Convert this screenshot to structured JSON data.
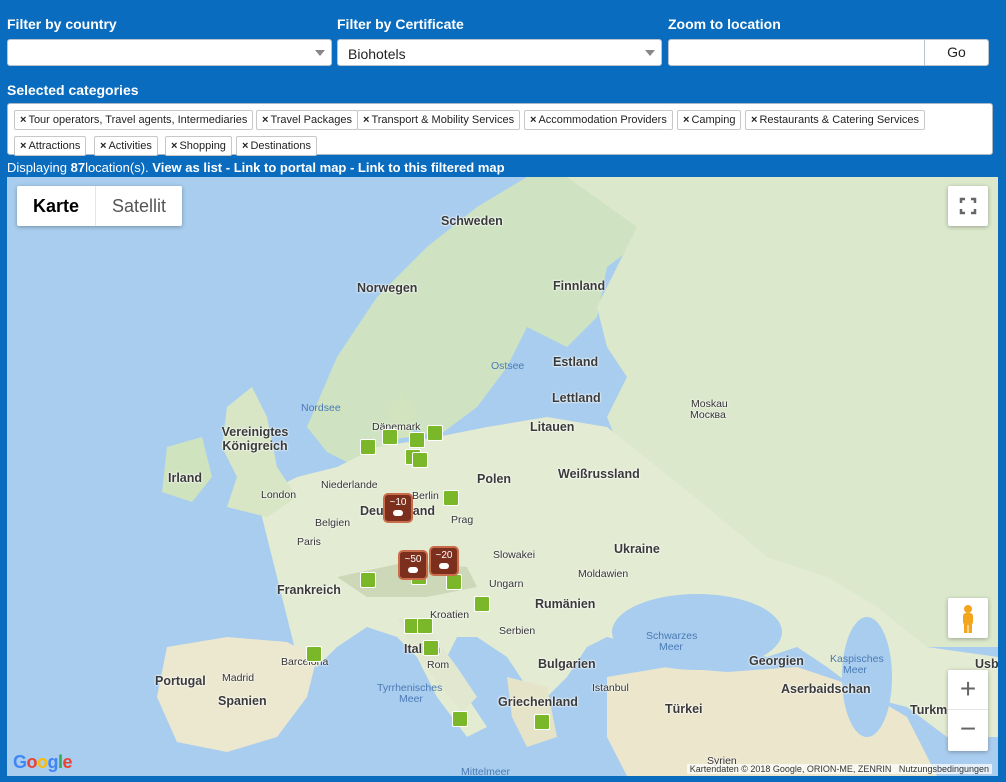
{
  "filters": {
    "country_label": "Filter by country",
    "country_value": "",
    "certificate_label": "Filter by Certificate",
    "certificate_value": "Biohotels",
    "zoom_label": "Zoom to location",
    "zoom_value": "",
    "go_label": "Go"
  },
  "categories": {
    "label": "Selected categories",
    "items": [
      "Tour operators, Travel agents, Intermediaries",
      "Travel Packages",
      "Transport & Mobility Services",
      "Accommodation Providers",
      "Camping",
      "Restaurants & Catering Services",
      "Attractions",
      "Activities",
      "Shopping",
      "Destinations"
    ],
    "remove_symbol": "×"
  },
  "info": {
    "prefix": "Displaying ",
    "count": "87",
    "suffix": "location(s). ",
    "view_list": "View as list",
    "sep1": " - ",
    "portal_map": "Link to portal map",
    "sep2": " - ",
    "filtered_map": "Link to this filtered map"
  },
  "map": {
    "map_type_active": "Karte",
    "map_type_other": "Satellit",
    "zoom_in": "+",
    "zoom_out": "−",
    "attribution": "Kartendaten © 2018 Google, ORION-ME, ZENRIN",
    "terms": "Nutzungsbedingungen",
    "countries": [
      "Schweden",
      "Finnland",
      "Norwegen",
      "Estland",
      "Lettland",
      "Litauen",
      "Vereinigtes Königreich",
      "Irland",
      "Dänemark",
      "Polen",
      "Weißrussland",
      "Niederlande",
      "Belgien",
      "Deutschland",
      "Ukraine",
      "Slowakei",
      "Frankreich",
      "Moldawien",
      "Ungarn",
      "Rumänien",
      "Kroatien",
      "Serbien",
      "Italien",
      "Bulgarien",
      "Georgien",
      "Portugal",
      "Spanien",
      "Griechenland",
      "Türkei",
      "Aserbaidschan",
      "Usb",
      "Turkm",
      "Syrien"
    ],
    "cities": [
      "London",
      "Paris",
      "Berlin",
      "Prag",
      "Moskau",
      "Москва",
      "Madrid",
      "Barcelona",
      "Rom",
      "Istanbul"
    ],
    "seas": [
      "Nordsee",
      "Ostsee",
      "Schwarzes",
      "Meer",
      "Tyrrhenisches",
      "Meer",
      "Kaspisches",
      "Meer",
      "Mittelmeer"
    ],
    "clusters": [
      "~10",
      "~50",
      "~20"
    ]
  }
}
